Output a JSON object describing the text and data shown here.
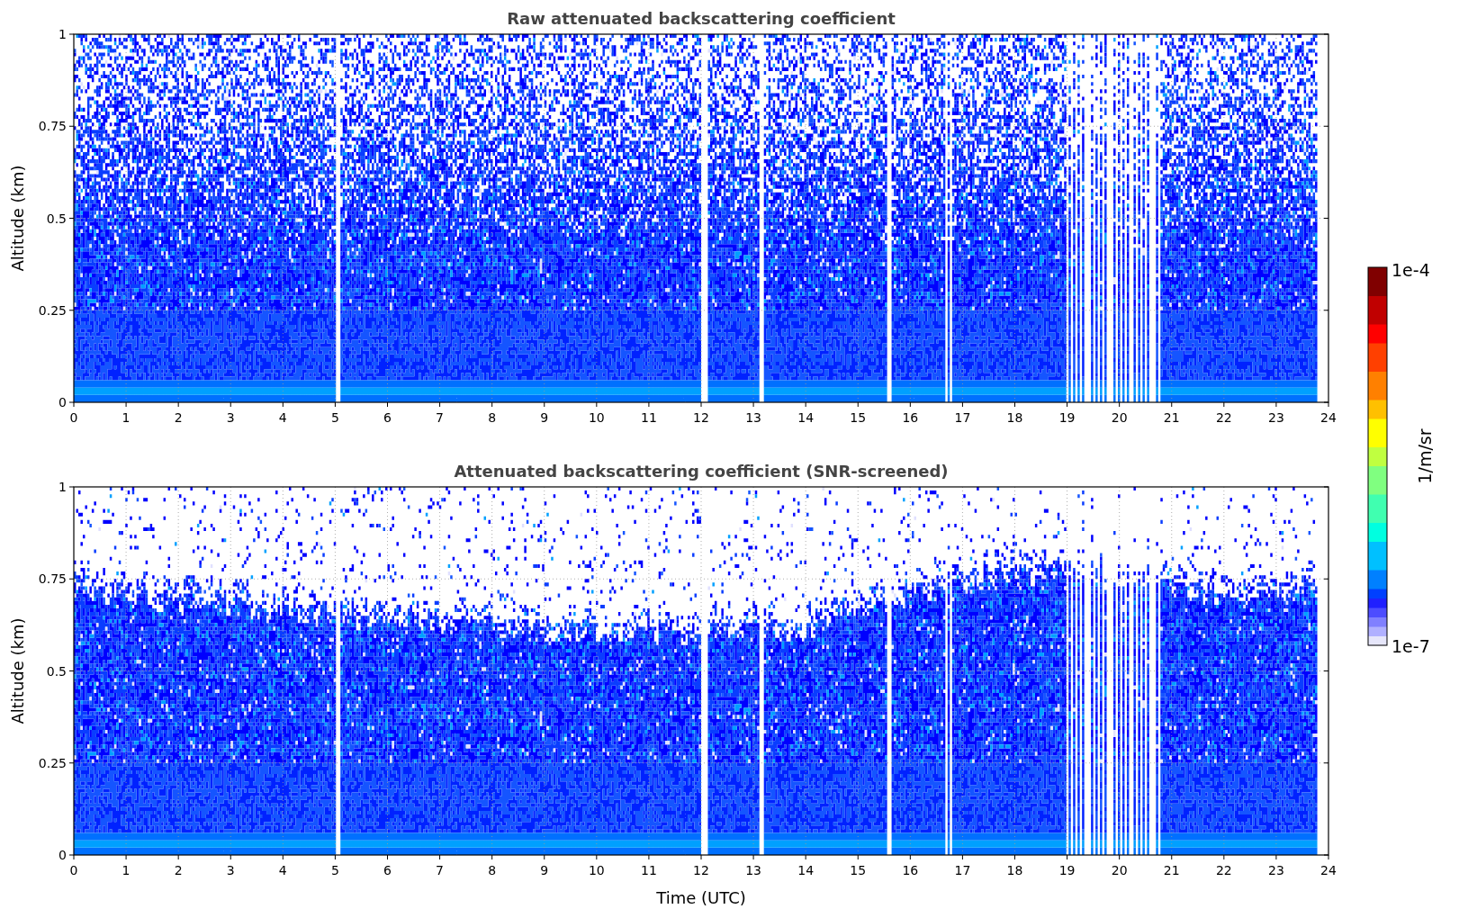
{
  "plots": [
    {
      "kind": "raw",
      "title": "Raw attenuated backscattering coefficient",
      "ylabel": "Altitude (km)",
      "yticks": [
        "1",
        "0.75",
        "0.5",
        "0.25",
        "0"
      ],
      "xticks": [
        "0",
        "1",
        "2",
        "3",
        "4",
        "5",
        "6",
        "7",
        "8",
        "9",
        "10",
        "11",
        "12",
        "13",
        "14",
        "15",
        "16",
        "17",
        "18",
        "19",
        "20",
        "21",
        "22",
        "23",
        "24"
      ]
    },
    {
      "kind": "screened",
      "title": "Attenuated backscattering coefficient (SNR-screened)",
      "ylabel": "Altitude (km)",
      "yticks": [
        "1",
        "0.75",
        "0.5",
        "0.25",
        "0"
      ],
      "xticks": [
        "0",
        "1",
        "2",
        "3",
        "4",
        "5",
        "6",
        "7",
        "8",
        "9",
        "10",
        "11",
        "12",
        "13",
        "14",
        "15",
        "16",
        "17",
        "18",
        "19",
        "20",
        "21",
        "22",
        "23",
        "24"
      ],
      "xlabel": "Time (UTC)"
    }
  ],
  "colorbar": {
    "label": "1/m/sr",
    "max_label": "1e-4",
    "min_label": "1e-7"
  }
}
